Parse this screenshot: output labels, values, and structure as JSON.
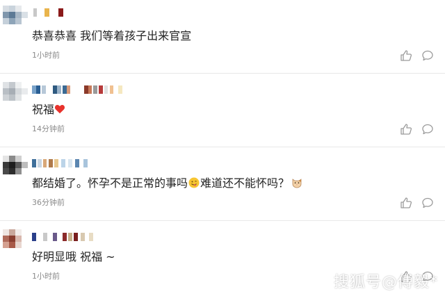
{
  "comments": [
    {
      "text": "恭喜恭喜 我们等着孩子出来官宣",
      "time": "1小时前"
    },
    {
      "text": "祝福",
      "time": "14分钟前"
    },
    {
      "text_a": "都结婚了。怀孕不是正常的事吗",
      "text_b": "难道还不能怀吗？",
      "time": "36分钟前"
    },
    {
      "text": "好明显哦 祝福 ~",
      "time": "1小时前"
    }
  ],
  "icons": {
    "like": "thumbs-up-icon",
    "reply": "comment-bubble-icon",
    "heart": "red-heart-emoji",
    "smile": "tongue-smile-emoji",
    "cat": "cat-face-emoji"
  },
  "colors": {
    "text": "#222222",
    "time": "#8a8a8a",
    "divider": "#e8e8e8",
    "icon": "#9a9a9a",
    "heart": "#e8322c"
  },
  "watermark": "搜狐号@傅毅*"
}
